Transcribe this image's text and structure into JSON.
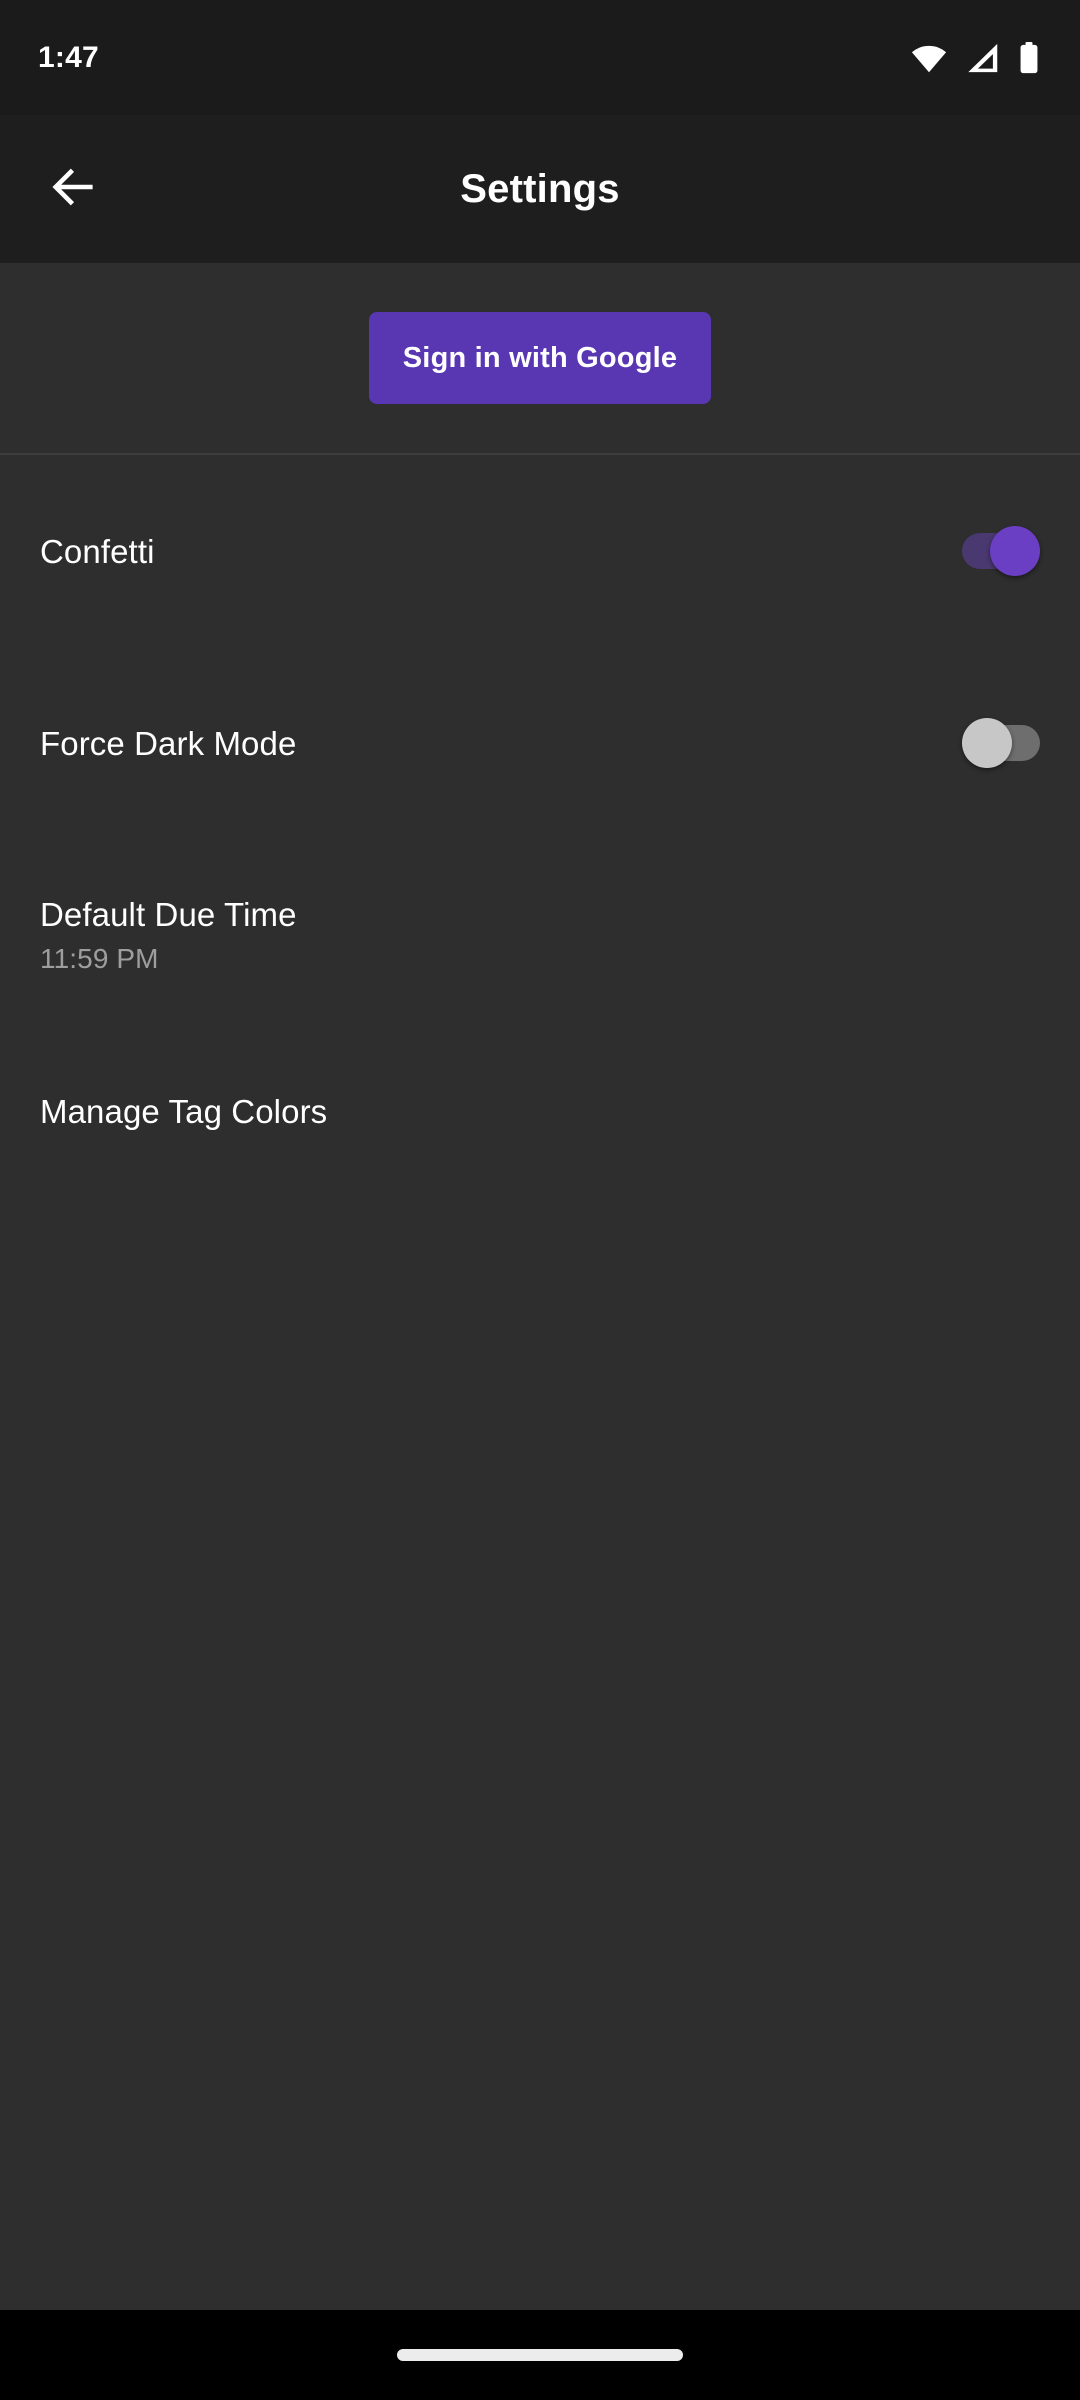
{
  "status_bar": {
    "time": "1:47",
    "icons": [
      {
        "name": "wifi-icon",
        "label": "Wi-Fi"
      },
      {
        "name": "cellular-signal-icon",
        "label": "Cellular signal"
      },
      {
        "name": "battery-icon",
        "label": "Battery full"
      }
    ]
  },
  "app_bar": {
    "back_icon": "back-arrow-icon",
    "title": "Settings"
  },
  "signin": {
    "button_label": "Sign in with Google",
    "button_color": "#5937b3",
    "button_text_color": "#ffffff"
  },
  "settings": {
    "items": [
      {
        "id": "confetti",
        "title": "Confetti",
        "subtitle": "",
        "control": "switch",
        "switch_on": true,
        "track_color": "#4a3870",
        "thumb_color": "#6a3fc4"
      },
      {
        "id": "force-dark-mode",
        "title": "Force Dark Mode",
        "subtitle": "",
        "control": "switch",
        "switch_on": false,
        "track_color": "#6e6e6e",
        "thumb_color": "#c7c7c7"
      },
      {
        "id": "default-due-time",
        "title": "Default Due Time",
        "subtitle": "11:59 PM",
        "control": "none",
        "switch_on": null
      },
      {
        "id": "manage-tag-colors",
        "title": "Manage Tag Colors",
        "subtitle": "",
        "control": "none",
        "switch_on": null
      }
    ]
  },
  "nav_bar": {
    "gesture_pill": "home-gesture-pill"
  },
  "theme": {
    "status_bar_bg": "#1b1b1b",
    "app_bar_bg": "#1e1e1e",
    "content_bg": "#2e2e2e",
    "divider": "#3d3d3d",
    "nav_bar_bg": "#000000",
    "primary_text": "#ffffff",
    "secondary_text": "#9e9e9e",
    "accent": "#5937b3"
  }
}
